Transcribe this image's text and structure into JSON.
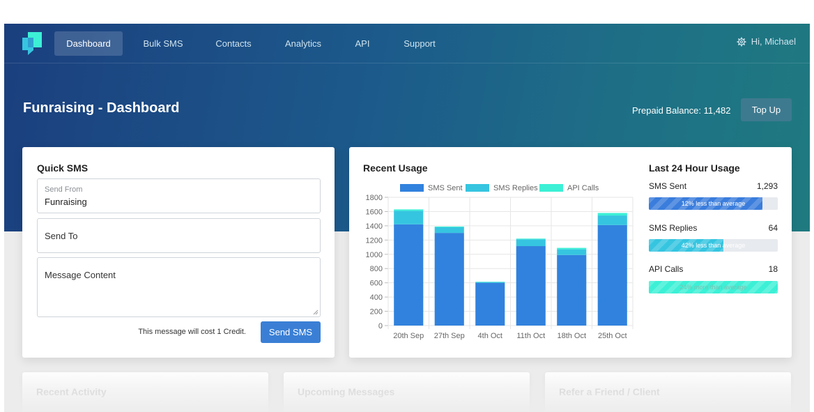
{
  "nav": {
    "items": [
      {
        "label": "Dashboard",
        "active": true
      },
      {
        "label": "Bulk SMS",
        "active": false
      },
      {
        "label": "Contacts",
        "active": false
      },
      {
        "label": "Analytics",
        "active": false
      },
      {
        "label": "API",
        "active": false
      },
      {
        "label": "Support",
        "active": false
      }
    ],
    "user_greeting": "Hi, Michael",
    "user_icon": "gear-icon",
    "logo_icon": "message-logo-icon"
  },
  "header": {
    "title": "Funraising - Dashboard",
    "balance_text": "Prepaid Balance: 11,482",
    "topup_label": "Top Up"
  },
  "quick_sms": {
    "title": "Quick SMS",
    "send_from_label": "Send From",
    "send_from_value": "Funraising",
    "send_to_placeholder": "Send To",
    "message_placeholder": "Message Content",
    "cost_text": "This message will cost 1 Credit.",
    "send_label": "Send SMS"
  },
  "recent_usage": {
    "title": "Recent Usage",
    "chart_data": {
      "type": "bar",
      "stacked": true,
      "categories": [
        "20th Sep",
        "27th Sep",
        "4th Oct",
        "11th Oct",
        "18th Oct",
        "25th Oct"
      ],
      "series": [
        {
          "name": "SMS Sent",
          "values": [
            1420,
            1300,
            600,
            1115,
            990,
            1410
          ],
          "color": "#3182de"
        },
        {
          "name": "SMS Replies",
          "values": [
            190,
            80,
            10,
            95,
            80,
            135
          ],
          "color": "#36c5e0"
        },
        {
          "name": "API Calls",
          "values": [
            20,
            10,
            5,
            10,
            20,
            35
          ],
          "color": "#3cf0d6"
        }
      ],
      "ylim": [
        0,
        1800
      ],
      "yticks": [
        0,
        200,
        400,
        600,
        800,
        1000,
        1200,
        1400,
        1600,
        1800
      ],
      "legend": "top",
      "grid": true
    }
  },
  "last24": {
    "title": "Last 24 Hour Usage",
    "items": [
      {
        "label": "SMS Sent",
        "value": "1,293",
        "bar_text": "12% less than average",
        "fill": 0.88,
        "color": "#3a7ddc"
      },
      {
        "label": "SMS Replies",
        "value": "64",
        "bar_text": "42% less than average",
        "fill": 0.58,
        "color": "#36c5e0"
      },
      {
        "label": "API Calls",
        "value": "18",
        "bar_text": "24% more than average",
        "fill": 1.0,
        "color": "#3cf0d6"
      }
    ]
  },
  "bottom_cards": [
    "Recent Activity",
    "Upcoming Messages",
    "Refer a Friend / Client"
  ]
}
